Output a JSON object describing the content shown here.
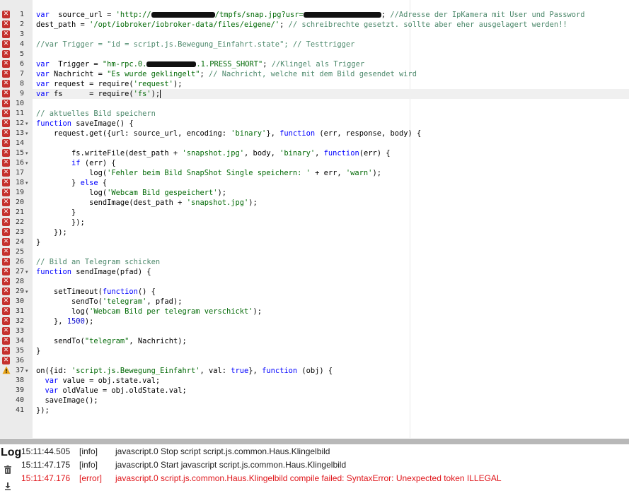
{
  "editor": {
    "active_line": 9,
    "lines": [
      {
        "n": "1",
        "marker": "error",
        "fold": "",
        "tokens": [
          [
            "kw",
            "var"
          ],
          [
            "",
            "  source_url = "
          ],
          [
            "str",
            "'http://"
          ],
          [
            "redact",
            ""
          ],
          [
            "str",
            "/tmpfs/snap.jpg?usr="
          ],
          [
            "redact",
            ""
          ],
          [
            "",
            "; "
          ],
          [
            "cm",
            "//Adresse der IpKamera mit User und Password"
          ]
        ]
      },
      {
        "n": "2",
        "marker": "error",
        "fold": "",
        "tokens": [
          [
            "",
            "dest_path = "
          ],
          [
            "str",
            "'/opt/iobroker/iobroker-data/files/eigene/'"
          ],
          [
            "",
            "; "
          ],
          [
            "cm",
            "// schreibrechte gesetzt. sollte aber eher ausgelagert werden!!"
          ]
        ]
      },
      {
        "n": "3",
        "marker": "error",
        "fold": "",
        "tokens": []
      },
      {
        "n": "4",
        "marker": "error",
        "fold": "",
        "tokens": [
          [
            "cm",
            "//var Trigger = \"id = script.js.Bewegung_Einfahrt.state\"; // Testtrigger"
          ]
        ]
      },
      {
        "n": "5",
        "marker": "error",
        "fold": "",
        "tokens": []
      },
      {
        "n": "6",
        "marker": "error",
        "fold": "",
        "tokens": [
          [
            "kw",
            "var"
          ],
          [
            "",
            "  Trigger = "
          ],
          [
            "str",
            "\"hm-rpc.0."
          ],
          [
            "redact",
            ""
          ],
          [
            "str",
            ".1.PRESS_SHORT\""
          ],
          [
            "",
            "; "
          ],
          [
            "cm",
            "//Klingel als Trigger"
          ]
        ]
      },
      {
        "n": "7",
        "marker": "error",
        "fold": "",
        "tokens": [
          [
            "kw",
            "var"
          ],
          [
            "",
            " Nachricht = "
          ],
          [
            "str",
            "\"Es wurde geklingelt\""
          ],
          [
            "",
            "; "
          ],
          [
            "cm",
            "// Nachricht, welche mit dem Bild gesendet wird"
          ]
        ]
      },
      {
        "n": "8",
        "marker": "error",
        "fold": "",
        "tokens": [
          [
            "kw",
            "var"
          ],
          [
            "",
            " request = require("
          ],
          [
            "str",
            "'request'"
          ],
          [
            "",
            ");"
          ]
        ]
      },
      {
        "n": "9",
        "marker": "error",
        "fold": "",
        "tokens": [
          [
            "kw",
            "var"
          ],
          [
            "",
            " fs      = require("
          ],
          [
            "str",
            "'fs'"
          ],
          [
            "",
            ");"
          ],
          [
            "cursor",
            ""
          ]
        ]
      },
      {
        "n": "10",
        "marker": "error",
        "fold": "",
        "tokens": []
      },
      {
        "n": "11",
        "marker": "error",
        "fold": "",
        "tokens": [
          [
            "cm",
            "// aktuelles Bild speichern"
          ]
        ]
      },
      {
        "n": "12",
        "marker": "error",
        "fold": "▾",
        "tokens": [
          [
            "kw",
            "function"
          ],
          [
            "",
            " saveImage() {"
          ]
        ]
      },
      {
        "n": "13",
        "marker": "error",
        "fold": "▾",
        "tokens": [
          [
            "",
            "    request.get({url: source_url, encoding: "
          ],
          [
            "str",
            "'binary'"
          ],
          [
            "",
            "}, "
          ],
          [
            "kw",
            "function"
          ],
          [
            "",
            " (err, response, body) {"
          ]
        ]
      },
      {
        "n": "14",
        "marker": "error",
        "fold": "",
        "tokens": []
      },
      {
        "n": "15",
        "marker": "error",
        "fold": "▾",
        "tokens": [
          [
            "",
            "        fs.writeFile(dest_path + "
          ],
          [
            "str",
            "'snapshot.jpg'"
          ],
          [
            "",
            ", body, "
          ],
          [
            "str",
            "'binary'"
          ],
          [
            "",
            ", "
          ],
          [
            "kw",
            "function"
          ],
          [
            "",
            "(err) {"
          ]
        ]
      },
      {
        "n": "16",
        "marker": "error",
        "fold": "▾",
        "tokens": [
          [
            "",
            "        "
          ],
          [
            "kw",
            "if"
          ],
          [
            "",
            " (err) {"
          ]
        ]
      },
      {
        "n": "17",
        "marker": "error",
        "fold": "",
        "tokens": [
          [
            "",
            "            log("
          ],
          [
            "str",
            "'Fehler beim Bild SnapShot Single speichern: '"
          ],
          [
            "",
            " + err, "
          ],
          [
            "str",
            "'warn'"
          ],
          [
            "",
            ");"
          ]
        ]
      },
      {
        "n": "18",
        "marker": "error",
        "fold": "▾",
        "tokens": [
          [
            "",
            "        } "
          ],
          [
            "kw",
            "else"
          ],
          [
            "",
            " {"
          ]
        ]
      },
      {
        "n": "19",
        "marker": "error",
        "fold": "",
        "tokens": [
          [
            "",
            "            log("
          ],
          [
            "str",
            "'Webcam Bild gespeichert'"
          ],
          [
            "",
            ");"
          ]
        ]
      },
      {
        "n": "20",
        "marker": "error",
        "fold": "",
        "tokens": [
          [
            "",
            "            sendImage(dest_path + "
          ],
          [
            "str",
            "'snapshot.jpg'"
          ],
          [
            "",
            ");"
          ]
        ]
      },
      {
        "n": "21",
        "marker": "error",
        "fold": "",
        "tokens": [
          [
            "",
            "        }"
          ]
        ]
      },
      {
        "n": "22",
        "marker": "error",
        "fold": "",
        "tokens": [
          [
            "",
            "        });"
          ]
        ]
      },
      {
        "n": "23",
        "marker": "error",
        "fold": "",
        "tokens": [
          [
            "",
            "    });"
          ]
        ]
      },
      {
        "n": "24",
        "marker": "error",
        "fold": "",
        "tokens": [
          [
            "",
            "}"
          ]
        ]
      },
      {
        "n": "25",
        "marker": "error",
        "fold": "",
        "tokens": []
      },
      {
        "n": "26",
        "marker": "error",
        "fold": "",
        "tokens": [
          [
            "cm",
            "// Bild an Telegram schicken"
          ]
        ]
      },
      {
        "n": "27",
        "marker": "error",
        "fold": "▾",
        "tokens": [
          [
            "kw",
            "function"
          ],
          [
            "",
            " sendImage(pfad) {"
          ]
        ]
      },
      {
        "n": "28",
        "marker": "error",
        "fold": "",
        "tokens": []
      },
      {
        "n": "29",
        "marker": "error",
        "fold": "▾",
        "tokens": [
          [
            "",
            "    setTimeout("
          ],
          [
            "kw",
            "function"
          ],
          [
            "",
            "() {"
          ]
        ]
      },
      {
        "n": "30",
        "marker": "error",
        "fold": "",
        "tokens": [
          [
            "",
            "        sendTo("
          ],
          [
            "str",
            "'telegram'"
          ],
          [
            "",
            ", pfad);"
          ]
        ]
      },
      {
        "n": "31",
        "marker": "error",
        "fold": "",
        "tokens": [
          [
            "",
            "        log("
          ],
          [
            "str",
            "'Webcam Bild per telegram verschickt'"
          ],
          [
            "",
            ");"
          ]
        ]
      },
      {
        "n": "32",
        "marker": "error",
        "fold": "",
        "tokens": [
          [
            "",
            "    }, "
          ],
          [
            "num",
            "1500"
          ],
          [
            "",
            ");"
          ]
        ]
      },
      {
        "n": "33",
        "marker": "error",
        "fold": "",
        "tokens": []
      },
      {
        "n": "34",
        "marker": "error",
        "fold": "",
        "tokens": [
          [
            "",
            "    sendTo("
          ],
          [
            "str",
            "\"telegram\""
          ],
          [
            "",
            ", Nachricht);"
          ]
        ]
      },
      {
        "n": "35",
        "marker": "error",
        "fold": "",
        "tokens": [
          [
            "",
            "}"
          ]
        ]
      },
      {
        "n": "36",
        "marker": "error",
        "fold": "",
        "tokens": []
      },
      {
        "n": "37",
        "marker": "warning",
        "fold": "▾",
        "tokens": [
          [
            "",
            "on({id: "
          ],
          [
            "str",
            "'script.js.Bewegung_Einfahrt'"
          ],
          [
            "",
            ", val: "
          ],
          [
            "kw",
            "true"
          ],
          [
            "",
            "}, "
          ],
          [
            "kw",
            "function"
          ],
          [
            "",
            " (obj) {"
          ]
        ]
      },
      {
        "n": "38",
        "marker": "",
        "fold": "",
        "tokens": [
          [
            "",
            "  "
          ],
          [
            "kw",
            "var"
          ],
          [
            "",
            " value = obj.state.val;"
          ]
        ]
      },
      {
        "n": "39",
        "marker": "",
        "fold": "",
        "tokens": [
          [
            "",
            "  "
          ],
          [
            "kw",
            "var"
          ],
          [
            "",
            " oldValue = obj.oldState.val;"
          ]
        ]
      },
      {
        "n": "40",
        "marker": "",
        "fold": "",
        "tokens": [
          [
            "",
            "  saveImage();"
          ]
        ]
      },
      {
        "n": "41",
        "marker": "",
        "fold": "",
        "tokens": [
          [
            "",
            "});"
          ]
        ]
      }
    ]
  },
  "log": {
    "title": "Log",
    "entries": [
      {
        "time": "15:11:44.505",
        "level": "[info]",
        "message": "javascript.0 Stop script script.js.common.Haus.Klingelbild",
        "kind": "info"
      },
      {
        "time": "15:11:47.175",
        "level": "[info]",
        "message": "javascript.0 Start javascript script.js.common.Haus.Klingelbild",
        "kind": "info"
      },
      {
        "time": "15:11:47.176",
        "level": "[error]",
        "message": "javascript.0 script.js.common.Haus.Klingelbild compile failed: SyntaxError: Unexpected token ILLEGAL",
        "kind": "error"
      }
    ],
    "icons": [
      "trash-icon",
      "download-icon"
    ]
  },
  "colors": {
    "error_marker": "#c5312e",
    "warning_marker": "#e8a317",
    "log_error": "#e0161b"
  }
}
